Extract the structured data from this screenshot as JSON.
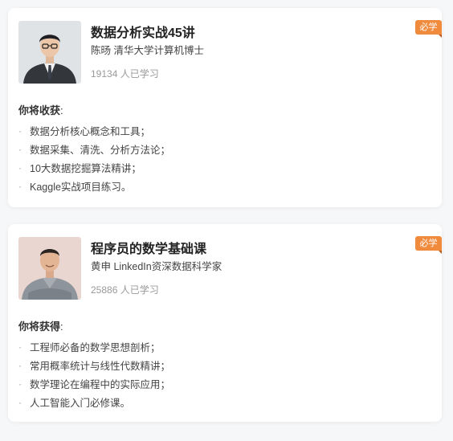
{
  "courses": [
    {
      "title": "数据分析实战45讲",
      "author": "陈旸 清华大学计算机博士",
      "learners": "19134 人已学习",
      "badge": "必学",
      "gain_heading": "你将收获",
      "gain_colon": ":",
      "bullet_symbol": "·",
      "gains": [
        "数据分析核心概念和工具；",
        "数据采集、清洗、分析方法论；",
        "10大数据挖掘算法精讲；",
        "Kaggle实战项目练习。"
      ]
    },
    {
      "title": "程序员的数学基础课",
      "author": "黄申 LinkedIn资深数据科学家",
      "learners": "25886 人已学习",
      "badge": "必学",
      "gain_heading": "你将获得",
      "gain_colon": ":",
      "bullet_symbol": "·",
      "gains": [
        "工程师必备的数学思想剖析；",
        "常用概率统计与线性代数精讲；",
        "数学理论在编程中的实际应用；",
        "人工智能入门必修课。"
      ]
    }
  ],
  "colors": {
    "badge": "#f08a3c",
    "title": "#222222",
    "muted": "#999999"
  },
  "icons": [
    "author-portrait"
  ]
}
